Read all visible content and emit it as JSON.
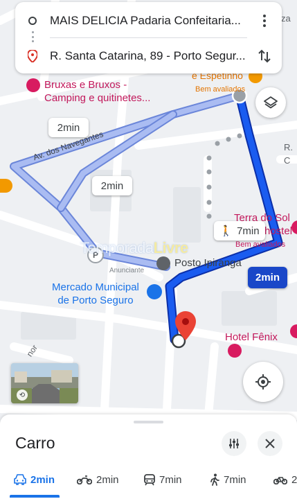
{
  "route": {
    "origin": "MAIS DELICIA Padaria Confeitaria...",
    "destination": "R. Santa Catarina, 89 - Porto Segur..."
  },
  "map": {
    "pois": {
      "bruxas": "Bruxas e Bruxos -\nCamping e quitinetes...",
      "espetinho": "e Espetinho",
      "espetinho_sub": "Bem avaliados",
      "terra_sol": "Terra do Sol",
      "terra_sol_hostel": "hostel",
      "terra_sol_sub": "Bem avaliados",
      "posto": "Posto Ipiranga",
      "mercado": "Mercado Municipal\nde Porto Seguro",
      "hotel": "Hotel Fênix",
      "anunciante": "Anunciante",
      "edge_top_right": "za",
      "edge_right_c": "R. C",
      "edge_left_bottom": "nor"
    },
    "street_name": "Av. dos Navegantes",
    "watermark_a": "Temporada",
    "watermark_b": "Livre",
    "time_chips": {
      "alt1": "2min",
      "alt2": "2min",
      "walk": "7min",
      "selected": "2min"
    }
  },
  "sheet": {
    "title": "Carro",
    "modes": [
      {
        "icon": "car-icon",
        "label": "2min"
      },
      {
        "icon": "motorcycle-icon",
        "label": "2min"
      },
      {
        "icon": "transit-icon",
        "label": "7min"
      },
      {
        "icon": "walk-icon",
        "label": "7min"
      },
      {
        "icon": "bicycle-icon",
        "label": "2"
      }
    ]
  },
  "colors": {
    "route_primary": "#1a47e8",
    "route_alt": "#9fb4f0",
    "accent": "#1a73e8",
    "pin": "#ea4335"
  }
}
